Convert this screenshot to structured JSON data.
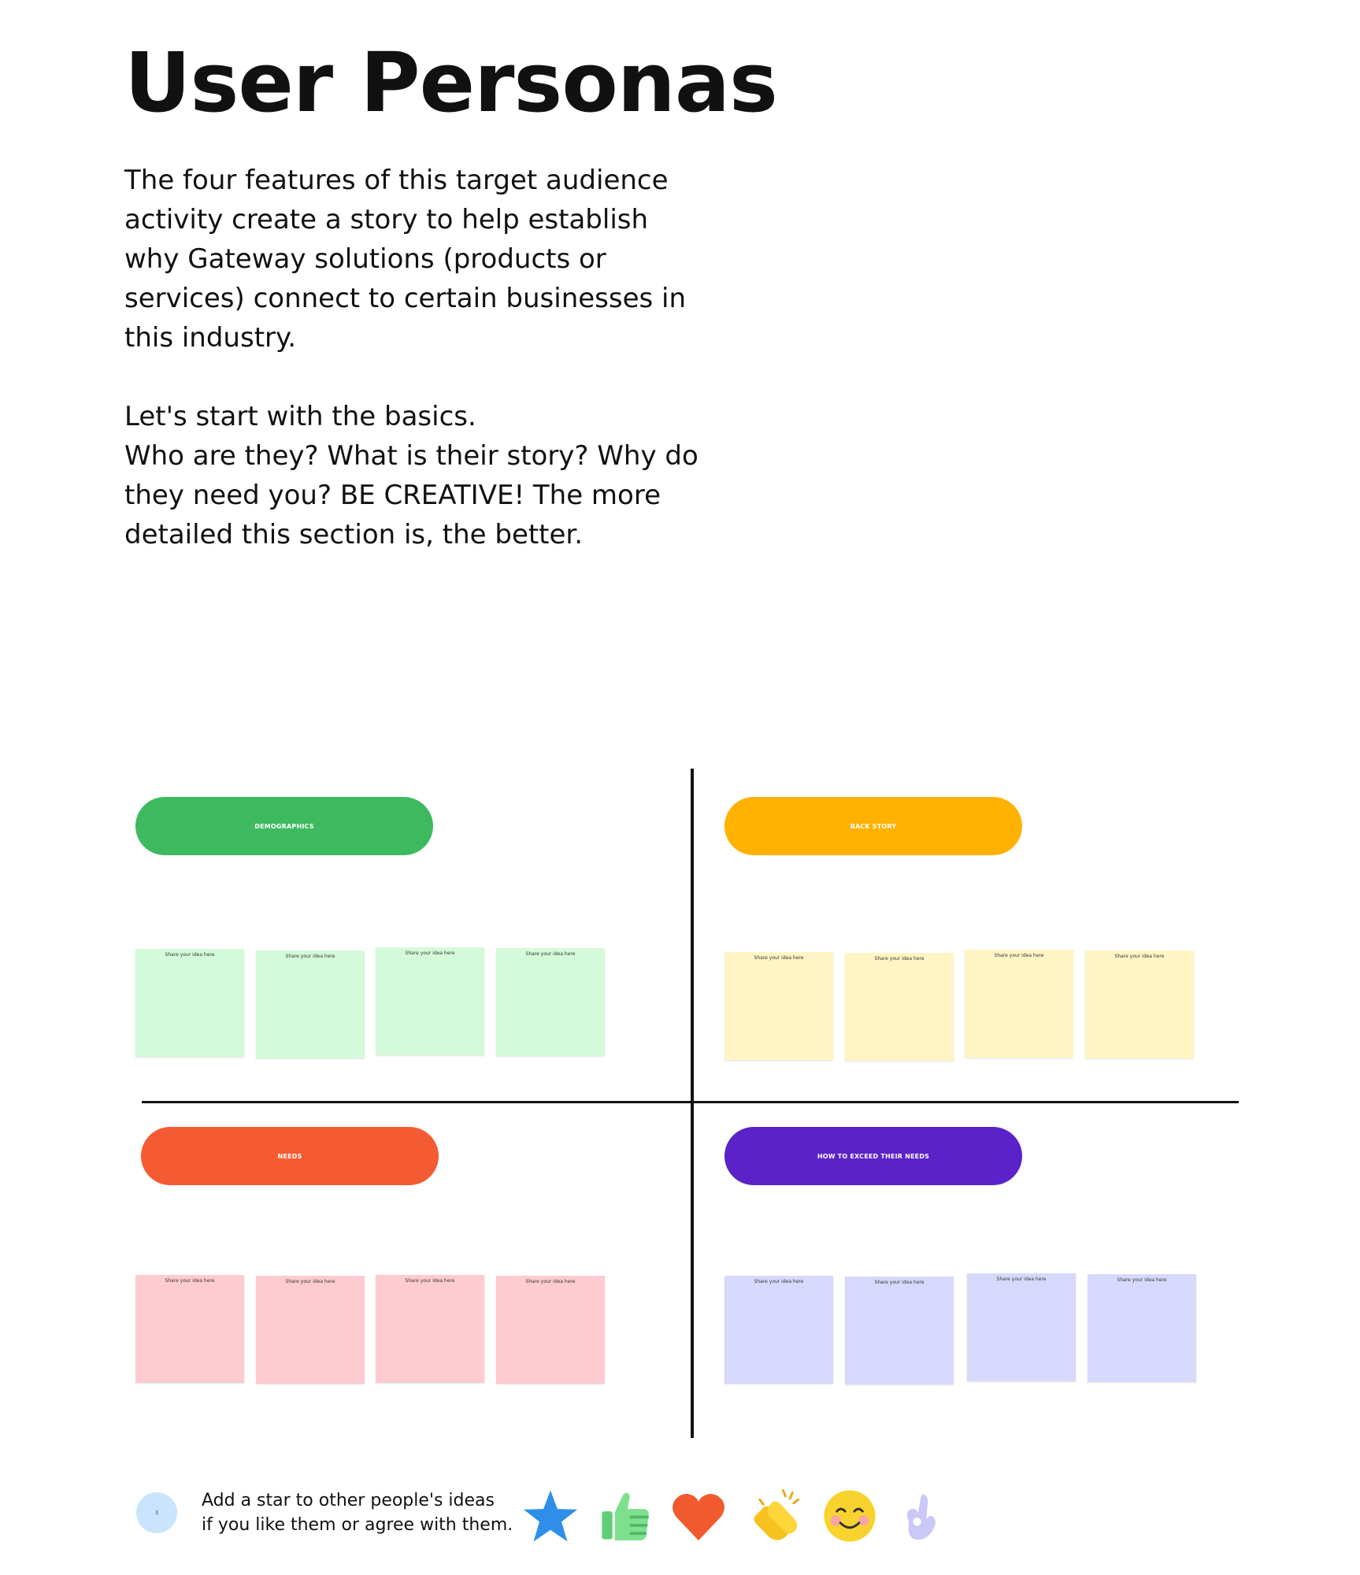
{
  "title": "User Personas",
  "intro": {
    "paragraph1": "The four features of this target audience activity create a story to help establish why Gateway solutions (products or services) connect to certain businesses in this industry.",
    "paragraph2_line1": "Let's start with the basics.",
    "paragraph2_line2": "Who are they? What is their story? Why do they need you? BE CREATIVE! The more detailed this section is, the better."
  },
  "sections": [
    {
      "label": "DEMOGRAPHICS",
      "color": "#3dba5f",
      "sticky_color": "#d4fbd9"
    },
    {
      "label": "BACK STORY",
      "color": "#ffb100",
      "sticky_color": "#fff5c4"
    },
    {
      "label": "NEEDS",
      "color": "#f45b32",
      "sticky_color": "#fdcbd0"
    },
    {
      "label": "HOW TO EXCEED THEIR NEEDS",
      "color": "#5a22c8",
      "sticky_color": "#d6d9fb"
    }
  ],
  "sticky_text": "Share your idea here",
  "footer": {
    "badge": "3",
    "line1": "Add a star to other people's ideas",
    "line2": "if you like them or agree with them.",
    "reactions": [
      "star-icon",
      "thumbs-up-icon",
      "heart-icon",
      "clapping-hands-icon",
      "smiling-face-icon",
      "ok-hand-icon"
    ]
  }
}
